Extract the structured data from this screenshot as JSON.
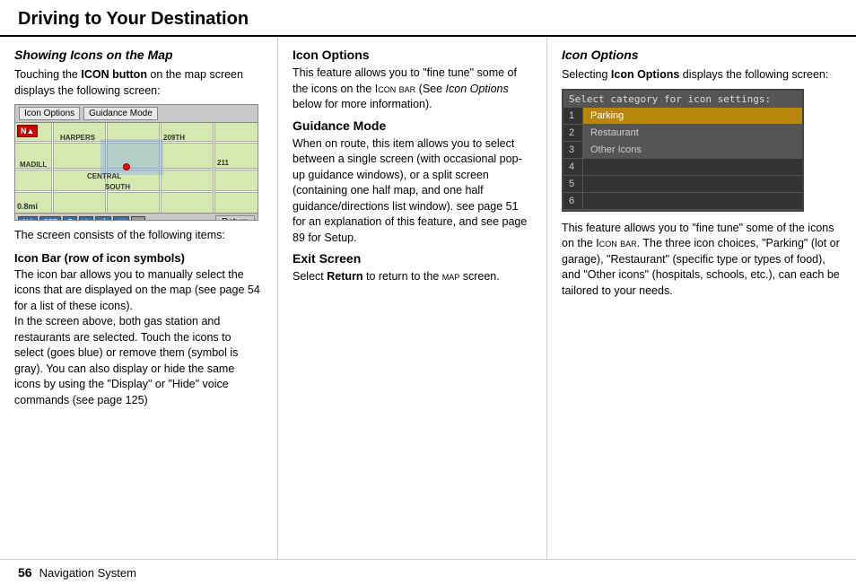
{
  "header": {
    "title": "Driving to Your Destination"
  },
  "left_column": {
    "section_title": "Showing Icons on the Map",
    "intro_text": "Touching the ",
    "intro_bold": "ICON button",
    "intro_text2": " on the map screen displays the following screen:",
    "map": {
      "btn1": "Icon Options",
      "btn2": "Guidance Mode",
      "roads": [
        "HARPERS",
        "MADILL",
        "CENTRAL",
        "209TH",
        "SOUTH",
        "211"
      ],
      "distance": "0.8mi",
      "return_btn": "Return"
    },
    "screen_text": "The screen consists of the following items:",
    "subsections": [
      {
        "title": "Icon Bar (row of icon symbols)",
        "body": "The icon bar allows you to manually select the icons that are displayed on the map (see page 54 for a list of these icons).\nIn the screen above, both gas station and restaurants are selected. Touch the icons to select (goes blue) or remove them (symbol is gray). You can also display or hide the same icons by using the \"Display\" or \"Hide\" voice commands (see page 125)"
      }
    ]
  },
  "middle_column": {
    "sections": [
      {
        "title": "Icon Options",
        "title_style": "bold",
        "body": "This feature allows you to “fine tune” some of the icons on the ",
        "inline_code": "Icon bar",
        "body2": " (See ",
        "italic": "Icon Options",
        "body3": " below for more information)."
      },
      {
        "title": "Guidance Mode",
        "body": "When on route, this item allows you to select between a single screen (with occasional pop-up guidance windows), or a split screen (containing one half map, and one half guidance/directions list window). see page 51 for an explanation of this feature, and see page 89 for Setup."
      },
      {
        "title": "Exit Screen",
        "body": "Select ",
        "bold": "Return",
        "body2": " to return to the ",
        "code": "map",
        "body3": " screen."
      }
    ]
  },
  "right_column": {
    "section_title": "Icon Options",
    "intro": "Selecting ",
    "intro_bold": "Icon Options",
    "intro2": " displays the following screen:",
    "screen": {
      "title": "Select category for icon settings:",
      "rows": [
        {
          "num": "1",
          "label": "Parking",
          "style": "parking"
        },
        {
          "num": "2",
          "label": "Restaurant",
          "style": "restaurant"
        },
        {
          "num": "3",
          "label": "Other Icons",
          "style": "other"
        },
        {
          "num": "4",
          "label": "",
          "style": "empty"
        },
        {
          "num": "5",
          "label": "",
          "style": "empty"
        },
        {
          "num": "6",
          "label": "",
          "style": "empty"
        }
      ]
    },
    "body": "This feature allows you to “fine tune” some of the icons on the ",
    "code": "Icon bar",
    "body2": ". The three icon choices, “Parking” (lot or garage), “Restaurant” (specific type or types of food), and “Other icons” (hospitals, schools, etc.), can each be tailored to your needs."
  },
  "footer": {
    "page_number": "56",
    "app_name": "Navigation System"
  }
}
